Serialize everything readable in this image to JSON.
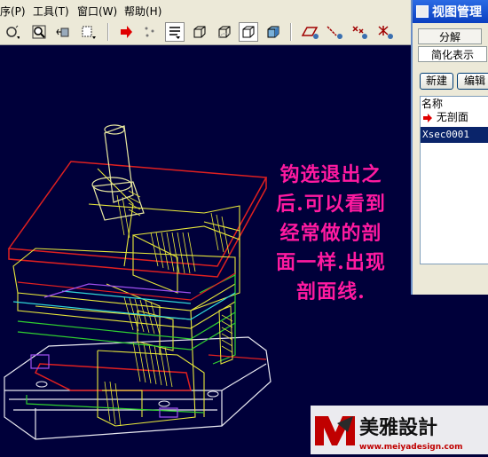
{
  "menubar": {
    "items": [
      "序(P)",
      "工具(T)",
      "窗口(W)",
      "帮助(H)"
    ]
  },
  "toolbar": {
    "icons": [
      "spin-center-icon",
      "zoom-window-icon",
      "refit-icon",
      "orient-icon",
      "redraw-arrow-icon",
      "datum-point-icon",
      "model-tree-icon",
      "wireframe-icon",
      "hidden-line-icon",
      "no-hidden-icon",
      "shading-icon",
      "datum-plane-icon",
      "datum-axis-icon",
      "datum-point-display-icon",
      "coordinate-system-icon"
    ]
  },
  "annotation": {
    "lines": [
      "钩选退出之",
      "后.可以看到",
      "经常做的剖",
      "面一样.出现",
      "剖面线."
    ]
  },
  "view_manager": {
    "title": "视图管理",
    "tabs": [
      "分解",
      "简化表示"
    ],
    "buttons": [
      "新建",
      "编辑"
    ],
    "column_header": "名称",
    "rows": [
      {
        "label": "无剖面",
        "selected": false,
        "icon": "red-arrow-icon"
      },
      {
        "label": "Xsec0001",
        "selected": true
      }
    ]
  },
  "watermark": {
    "brand": "美雅設計",
    "url": "www.meiyadesign.com"
  },
  "colors": {
    "canvas_bg": "#00003a",
    "annotation": "#ff1aa0",
    "selection": "#0a246a",
    "title_bar": "#0a3fc0"
  }
}
